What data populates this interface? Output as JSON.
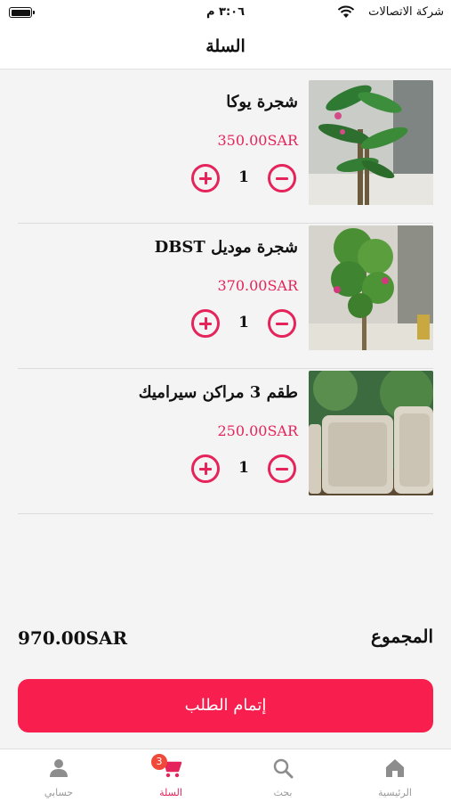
{
  "status_bar": {
    "time": "٣:٠٦ م",
    "carrier": "شركة الاتصالات"
  },
  "header": {
    "title": "السلة"
  },
  "cart_items": [
    {
      "name": "شجرة يوكا",
      "price": "350.00SAR",
      "quantity": "1"
    },
    {
      "name": "شجرة موديل DBST",
      "price": "370.00SAR",
      "quantity": "1"
    },
    {
      "name": "طقم 3 مراكن سيراميك",
      "price": "250.00SAR",
      "quantity": "1"
    }
  ],
  "total": {
    "label": "المجموع",
    "value": "970.00SAR"
  },
  "checkout": {
    "label": "إتمام الطلب"
  },
  "tab_bar": {
    "tabs": [
      {
        "label": "الرئيسية",
        "icon": "home-icon"
      },
      {
        "label": "بحث",
        "icon": "search-icon"
      },
      {
        "label": "السلة",
        "icon": "cart-icon",
        "badge": "3"
      },
      {
        "label": "حسابي",
        "icon": "account-icon"
      }
    ]
  },
  "colors": {
    "accent": "#e4245a",
    "checkout": "#f81f4f",
    "badge": "#f0493a"
  }
}
